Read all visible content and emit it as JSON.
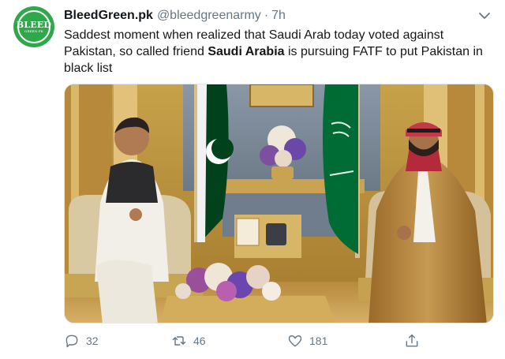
{
  "tweet": {
    "author_name": "BleedGreen.pk",
    "author_handle": "@bleedgreenarmy",
    "separator": "·",
    "time_ago": "7h",
    "avatar_text": "BLEED",
    "avatar_subtext": "GREEN.PK",
    "text_before": "Saddest moment when realized that Saudi Arab today voted against Pakistan, so called friend ",
    "text_bold": "Saudi Arabia",
    "text_after": " is pursuing FATF to put Pakistan in black list"
  },
  "actions": {
    "reply_count": "32",
    "retweet_count": "46",
    "like_count": "181"
  },
  "icons": [
    "chevron-down-icon",
    "reply-icon",
    "retweet-icon",
    "like-icon",
    "share-icon"
  ],
  "colors": {
    "avatar_green": "#2ea84a",
    "text_primary": "#14171a",
    "text_secondary": "#657786",
    "pakistan_flag": "#01411c",
    "saudi_flag": "#006c35"
  }
}
